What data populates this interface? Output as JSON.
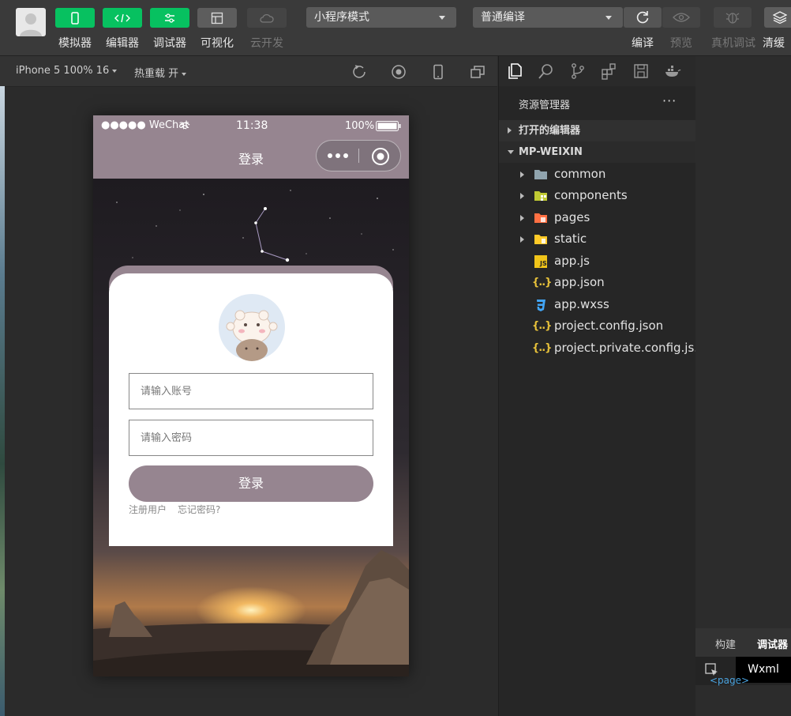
{
  "toolbar": {
    "buttons": [
      {
        "label": "模拟器"
      },
      {
        "label": "编辑器"
      },
      {
        "label": "调试器"
      },
      {
        "label": "可视化"
      },
      {
        "label": "云开发"
      }
    ],
    "mode_select": "小程序模式",
    "compile_select": "普通编译",
    "right_labels": [
      "编译",
      "预览",
      "真机调试",
      "清缓"
    ]
  },
  "sim_bar": {
    "device": "iPhone 5 100% 16",
    "hot_reload": "热重载 开"
  },
  "phone": {
    "carrier": "●●●●● WeChat",
    "time": "11:38",
    "battery": "100%",
    "nav_title": "登录",
    "account_placeholder": "请输入账号",
    "password_placeholder": "请输入密码",
    "login_button": "登录",
    "register_link": "注册用户",
    "forgot_link": "忘记密码?",
    "theme_color": "#968590"
  },
  "explorer": {
    "title": "资源管理器",
    "more": "···",
    "open_editors": "打开的编辑器",
    "project": "MP-WEIXIN",
    "items": [
      {
        "name": "common"
      },
      {
        "name": "components"
      },
      {
        "name": "pages"
      },
      {
        "name": "static"
      },
      {
        "name": "app.js"
      },
      {
        "name": "app.json"
      },
      {
        "name": "app.wxss"
      },
      {
        "name": "project.config.json"
      },
      {
        "name": "project.private.config.js..."
      }
    ]
  },
  "debug": {
    "tabs": [
      "构建",
      "调试器"
    ],
    "wxml_tab": "Wxml",
    "page_tag": "<page>"
  }
}
